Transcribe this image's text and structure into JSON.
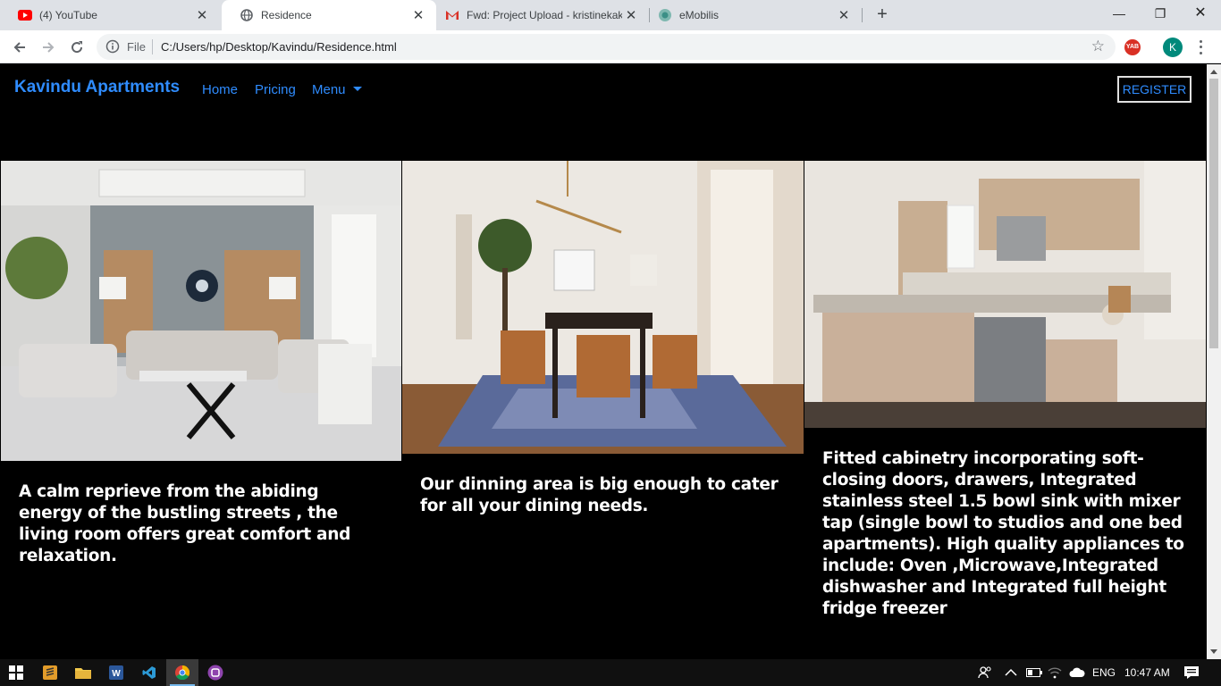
{
  "browser": {
    "tabs": [
      {
        "title": "(4) YouTube",
        "icon": "youtube-icon",
        "active": false
      },
      {
        "title": "Residence",
        "icon": "globe-icon",
        "active": true
      },
      {
        "title": "Fwd: Project Upload - kristinekak",
        "icon": "gmail-icon",
        "active": false
      },
      {
        "title": "eMobilis",
        "icon": "emobilis-icon",
        "active": false
      }
    ],
    "new_tab": "+",
    "url_scheme": "File",
    "url": "C:/Users/hp/Desktop/Kavindu/Residence.html",
    "extension_label": "YAB",
    "profile_initial": "K",
    "colors": {
      "tabbar": "#dee1e6",
      "profile": "#00897b"
    }
  },
  "site": {
    "brand": "Kavindu Apartments",
    "nav": {
      "home": "Home",
      "pricing": "Pricing",
      "menu": "Menu"
    },
    "register": "REGISTER",
    "accent": "#2f8cff",
    "cards": [
      {
        "image": "living-room-photo",
        "caption": "A calm reprieve from the abiding energy of the bustling streets , the living room offers great comfort and relaxation."
      },
      {
        "image": "dining-room-photo",
        "caption": "Our dinning area is big enough to cater for all your dining needs."
      },
      {
        "image": "kitchen-photo",
        "caption": "Fitted cabinetry incorporating soft-closing doors, drawers, Integrated stainless steel 1.5 bowl sink with mixer tap (single bowl to studios and one bed apartments). High quality appliances to include: Oven ,Microwave,Integrated dishwasher and Integrated full height fridge freezer"
      }
    ]
  },
  "taskbar": {
    "language": "ENG",
    "time": "10:47 AM"
  }
}
